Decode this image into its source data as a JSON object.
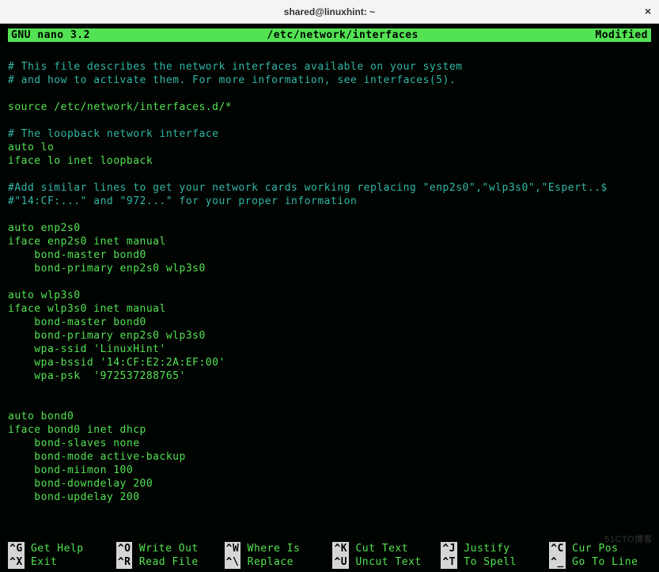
{
  "window": {
    "title": "shared@linuxhint: ~",
    "close": "×"
  },
  "header": {
    "app": "GNU nano 3.2",
    "file": "/etc/network/interfaces",
    "status": "Modified"
  },
  "lines": [
    {
      "cls": "",
      "text": ""
    },
    {
      "cls": "comment",
      "text": "# This file describes the network interfaces available on your system"
    },
    {
      "cls": "comment",
      "text": "# and how to activate them. For more information, see interfaces(5)."
    },
    {
      "cls": "",
      "text": ""
    },
    {
      "cls": "",
      "text": "source /etc/network/interfaces.d/*"
    },
    {
      "cls": "",
      "text": ""
    },
    {
      "cls": "comment",
      "text": "# The loopback network interface"
    },
    {
      "cls": "",
      "text": "auto lo"
    },
    {
      "cls": "",
      "text": "iface lo inet loopback"
    },
    {
      "cls": "",
      "text": ""
    },
    {
      "cls": "comment",
      "text": "#Add similar lines to get your network cards working replacing \"enp2s0\",\"wlp3s0\",\"Espert..$"
    },
    {
      "cls": "comment",
      "text": "#\"14:CF:...\" and \"972...\" for your proper information"
    },
    {
      "cls": "",
      "text": ""
    },
    {
      "cls": "",
      "text": "auto enp2s0"
    },
    {
      "cls": "",
      "text": "iface enp2s0 inet manual"
    },
    {
      "cls": "",
      "text": "    bond-master bond0"
    },
    {
      "cls": "",
      "text": "    bond-primary enp2s0 wlp3s0"
    },
    {
      "cls": "",
      "text": ""
    },
    {
      "cls": "",
      "text": "auto wlp3s0"
    },
    {
      "cls": "",
      "text": "iface wlp3s0 inet manual"
    },
    {
      "cls": "",
      "text": "    bond-master bond0"
    },
    {
      "cls": "",
      "text": "    bond-primary enp2s0 wlp3s0"
    },
    {
      "cls": "",
      "text": "    wpa-ssid 'LinuxHint'"
    },
    {
      "cls": "",
      "text": "    wpa-bssid '14:CF:E2:2A:EF:00'"
    },
    {
      "cls": "",
      "text": "    wpa-psk  '972537288765'"
    },
    {
      "cls": "",
      "text": ""
    },
    {
      "cls": "",
      "text": ""
    },
    {
      "cls": "",
      "text": "auto bond0"
    },
    {
      "cls": "",
      "text": "iface bond0 inet dhcp"
    },
    {
      "cls": "",
      "text": "    bond-slaves none"
    },
    {
      "cls": "",
      "text": "    bond-mode active-backup"
    },
    {
      "cls": "",
      "text": "    bond-miimon 100"
    },
    {
      "cls": "",
      "text": "    bond-downdelay 200"
    },
    {
      "cls": "",
      "text": "    bond-updelay 200"
    }
  ],
  "shortcuts": [
    {
      "key": "^G",
      "label": "Get Help"
    },
    {
      "key": "^O",
      "label": "Write Out"
    },
    {
      "key": "^W",
      "label": "Where Is"
    },
    {
      "key": "^K",
      "label": "Cut Text"
    },
    {
      "key": "^J",
      "label": "Justify"
    },
    {
      "key": "^C",
      "label": "Cur Pos"
    },
    {
      "key": "^X",
      "label": "Exit"
    },
    {
      "key": "^R",
      "label": "Read File"
    },
    {
      "key": "^\\",
      "label": "Replace"
    },
    {
      "key": "^U",
      "label": "Uncut Text"
    },
    {
      "key": "^T",
      "label": "To Spell"
    },
    {
      "key": "^_",
      "label": "Go To Line"
    }
  ],
  "watermark": "51CTO博客"
}
